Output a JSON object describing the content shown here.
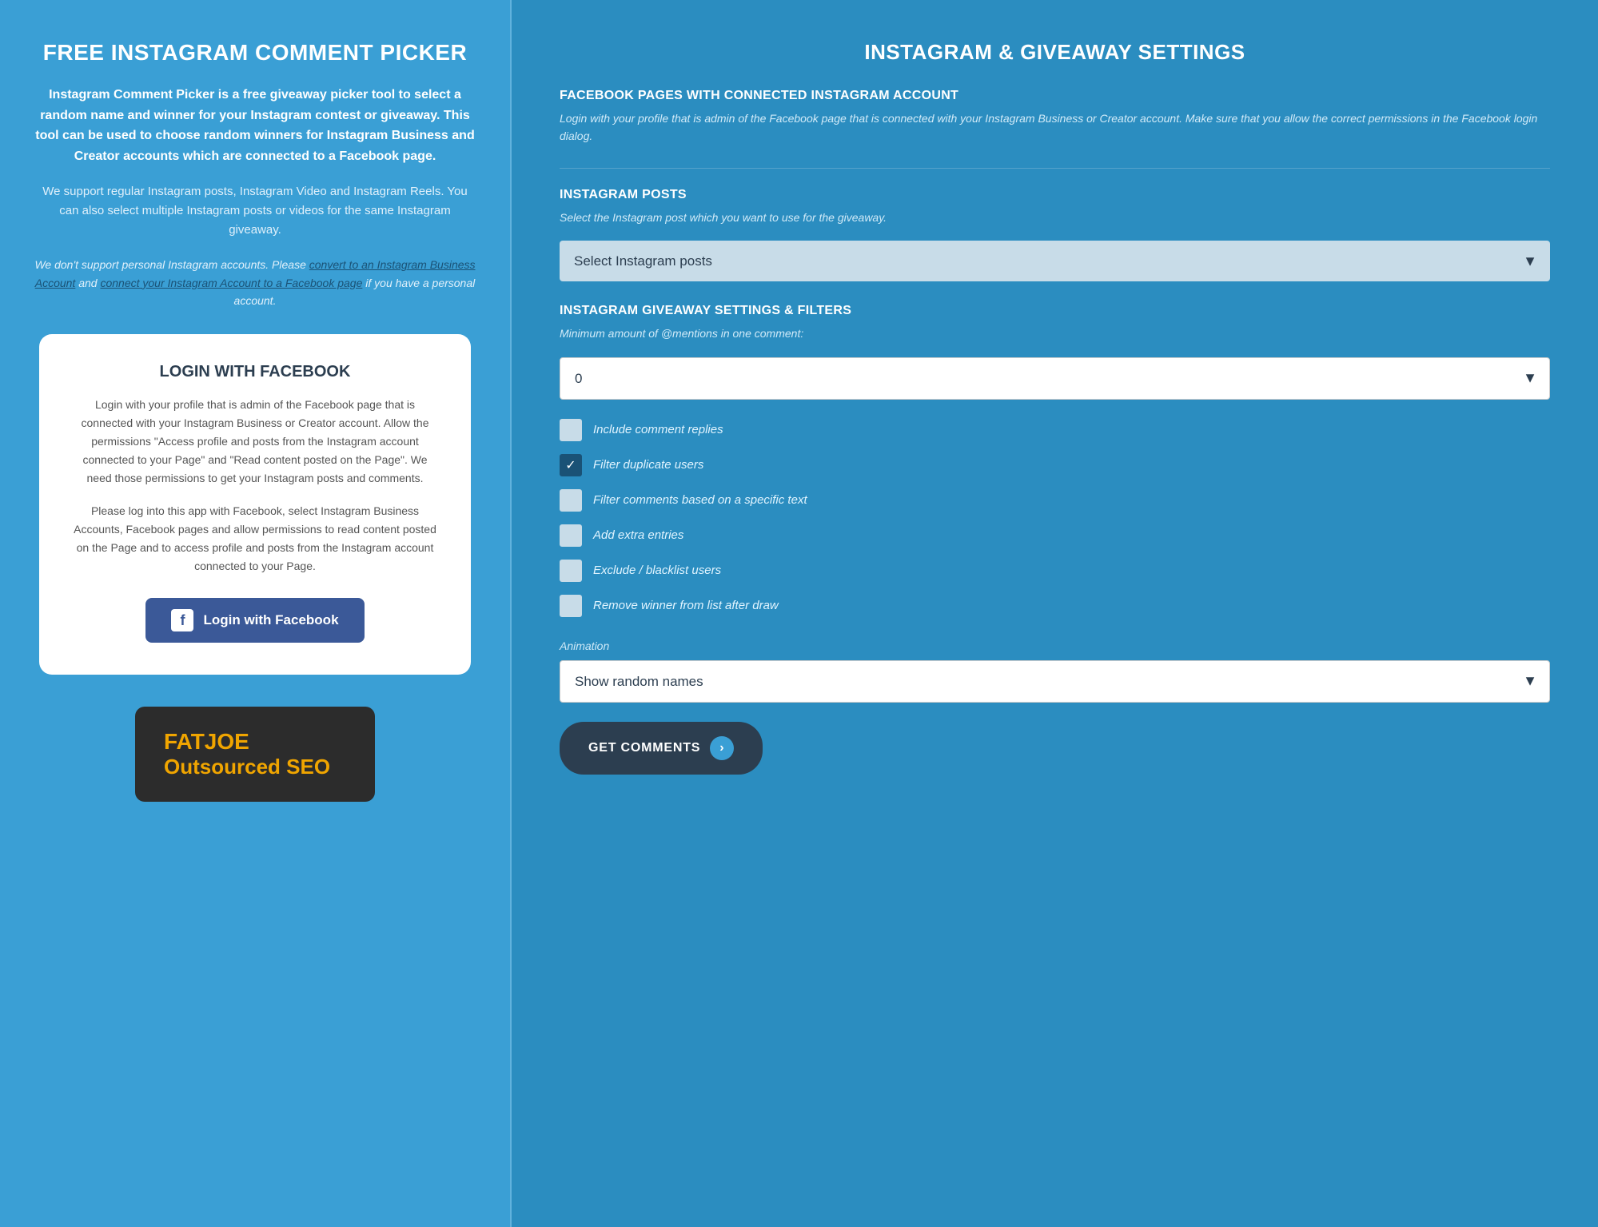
{
  "left": {
    "title": "FREE INSTAGRAM COMMENT PICKER",
    "desc": "Instagram Comment Picker is a free giveaway picker tool to select a random name and winner for your Instagram contest or giveaway. This tool can be used to choose random winners for Instagram Business and Creator accounts which are connected to a Facebook page.",
    "desc2": "We support regular Instagram posts, Instagram Video and Instagram Reels. You can also select multiple Instagram posts or videos for the same Instagram giveaway.",
    "note_prefix": "We don't support personal Instagram accounts. Please ",
    "link1_text": "convert to an Instagram Business Account",
    "note_middle": " and ",
    "link2_text": "connect your Instagram Account to a Facebook page",
    "note_suffix": " if you have a personal account.",
    "card": {
      "title": "LOGIN WITH FACEBOOK",
      "text1": "Login with your profile that is admin of the Facebook page that is connected with your Instagram Business or Creator account. Allow the permissions \"Access profile and posts from the Instagram account connected to your Page\" and \"Read content posted on the Page\". We need those permissions to get your Instagram posts and comments.",
      "text2": "Please log into this app with Facebook, select Instagram Business Accounts, Facebook pages and allow permissions to read content posted on the Page and to access profile and posts from the Instagram account connected to your Page.",
      "btn_label": "Login with Facebook"
    },
    "ad": {
      "brand": "FATJOE",
      "subtitle": "Outsourced SEO"
    }
  },
  "right": {
    "title": "INSTAGRAM & GIVEAWAY SETTINGS",
    "section1": {
      "heading": "FACEBOOK PAGES WITH CONNECTED INSTAGRAM ACCOUNT",
      "text": "Login with your profile that is admin of the Facebook page that is connected with your Instagram Business or Creator account. Make sure that you allow the correct permissions in the Facebook login dialog."
    },
    "section2": {
      "heading": "INSTAGRAM POSTS",
      "text": "Select the Instagram post which you want to use for the giveaway.",
      "dropdown_default": "Select Instagram posts"
    },
    "section3": {
      "heading": "INSTAGRAM GIVEAWAY SETTINGS & FILTERS",
      "text": "Minimum amount of @mentions in one comment:",
      "dropdown_default": "0",
      "checkboxes": [
        {
          "id": "include_replies",
          "label": "Include comment replies",
          "checked": false
        },
        {
          "id": "filter_duplicates",
          "label": "Filter duplicate users",
          "checked": true
        },
        {
          "id": "filter_text",
          "label": "Filter comments based on a specific text",
          "checked": false
        },
        {
          "id": "extra_entries",
          "label": "Add extra entries",
          "checked": false
        },
        {
          "id": "exclude_users",
          "label": "Exclude / blacklist users",
          "checked": false
        },
        {
          "id": "remove_winner",
          "label": "Remove winner from list after draw",
          "checked": false
        }
      ]
    },
    "animation": {
      "label": "Animation",
      "dropdown_default": "Show random names"
    },
    "get_comments_btn": "GET COMMENTS"
  }
}
